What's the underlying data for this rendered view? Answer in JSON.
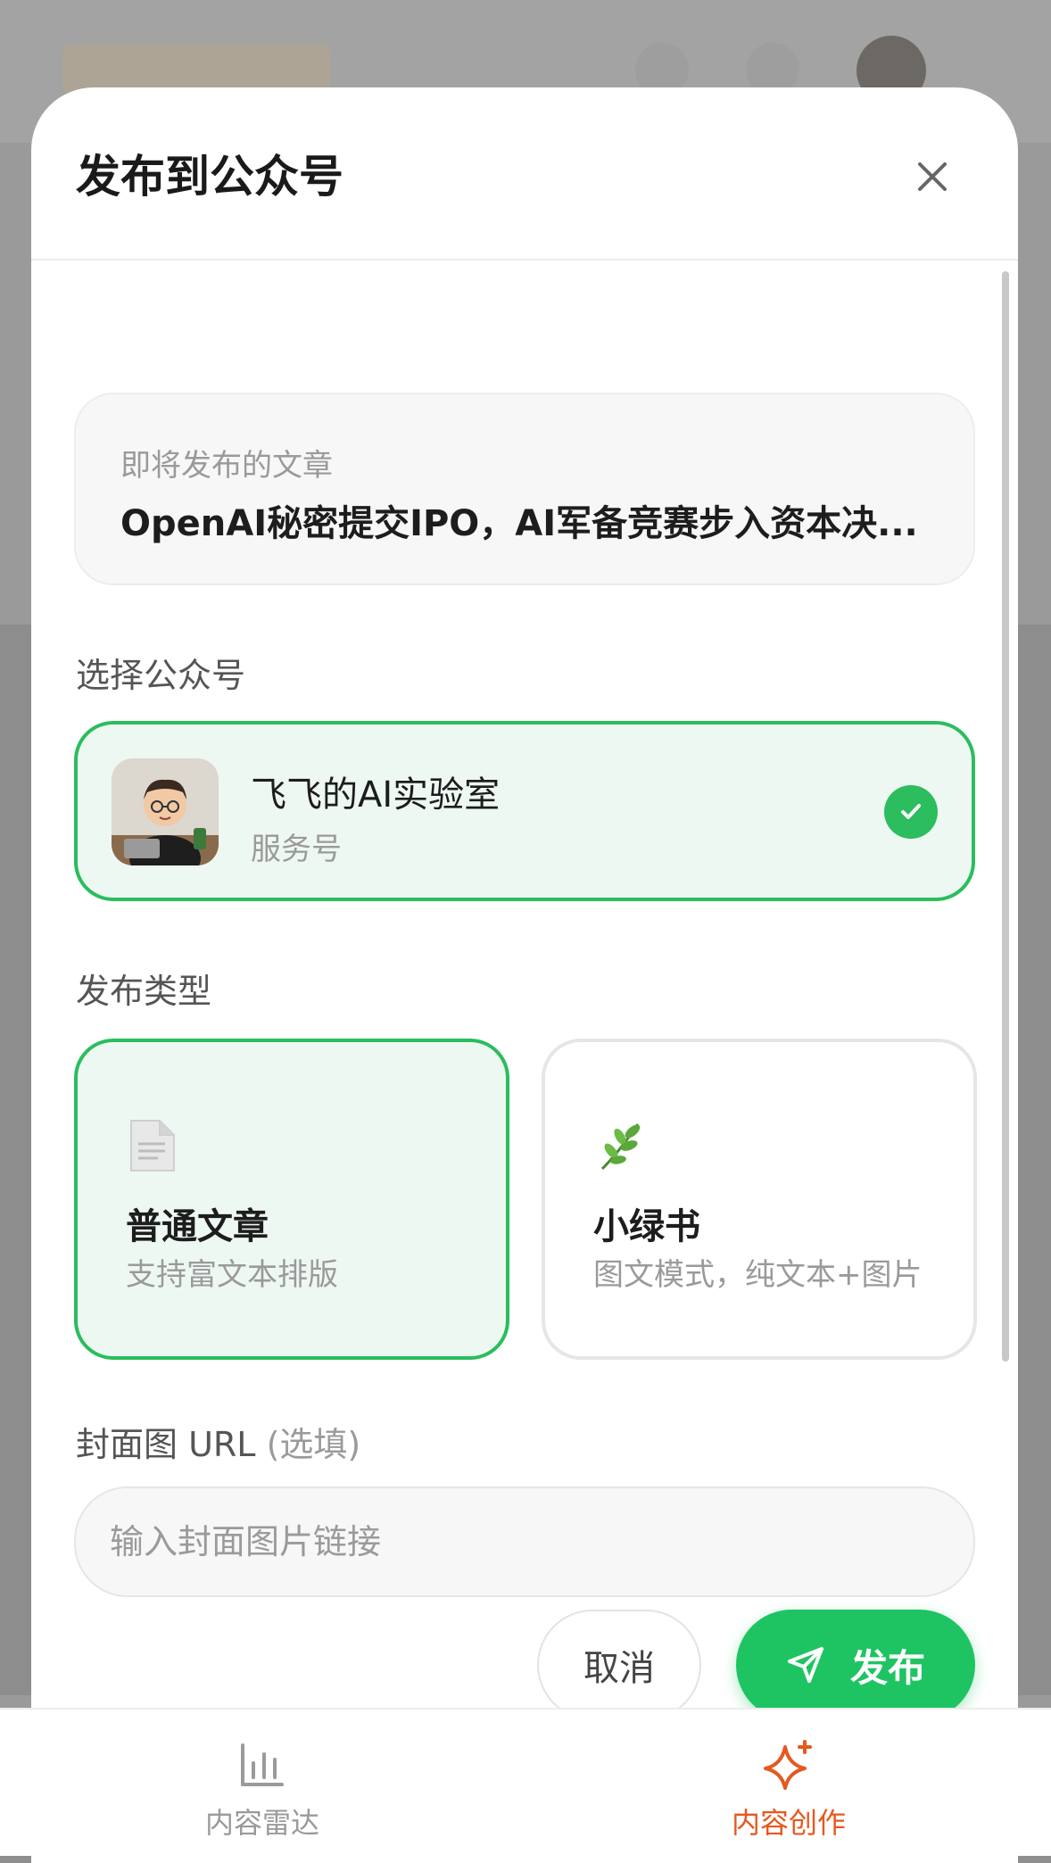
{
  "modal": {
    "title": "发布到公众号"
  },
  "article": {
    "label": "即将发布的文章",
    "title": "OpenAI秘密提交IPO，AI军备竞赛步入资本决..."
  },
  "account_section": {
    "label": "选择公众号",
    "selected": {
      "name": "飞飞的AI实验室",
      "type": "服务号"
    }
  },
  "publish_type": {
    "label": "发布类型",
    "options": [
      {
        "icon": "document-icon",
        "title": "普通文章",
        "desc": "支持富文本排版",
        "selected": true
      },
      {
        "icon": "herb-icon",
        "title": "小绿书",
        "desc": "图文模式，纯文本+图片",
        "selected": false
      }
    ]
  },
  "cover": {
    "label": "封面图 URL",
    "optional": "(选填)",
    "placeholder": "输入封面图片链接",
    "value": ""
  },
  "actions": {
    "cancel": "取消",
    "publish": "发布"
  },
  "bottom_nav": {
    "items": [
      {
        "label": "内容雷达",
        "icon": "bar-chart-icon",
        "active": false
      },
      {
        "label": "内容创作",
        "icon": "sparkle-icon",
        "active": true
      }
    ]
  },
  "colors": {
    "accent_green": "#2bbd5e",
    "publish_green": "#1fc462",
    "active_nav": "#e5591f",
    "inactive_nav": "#9a9a9a"
  }
}
